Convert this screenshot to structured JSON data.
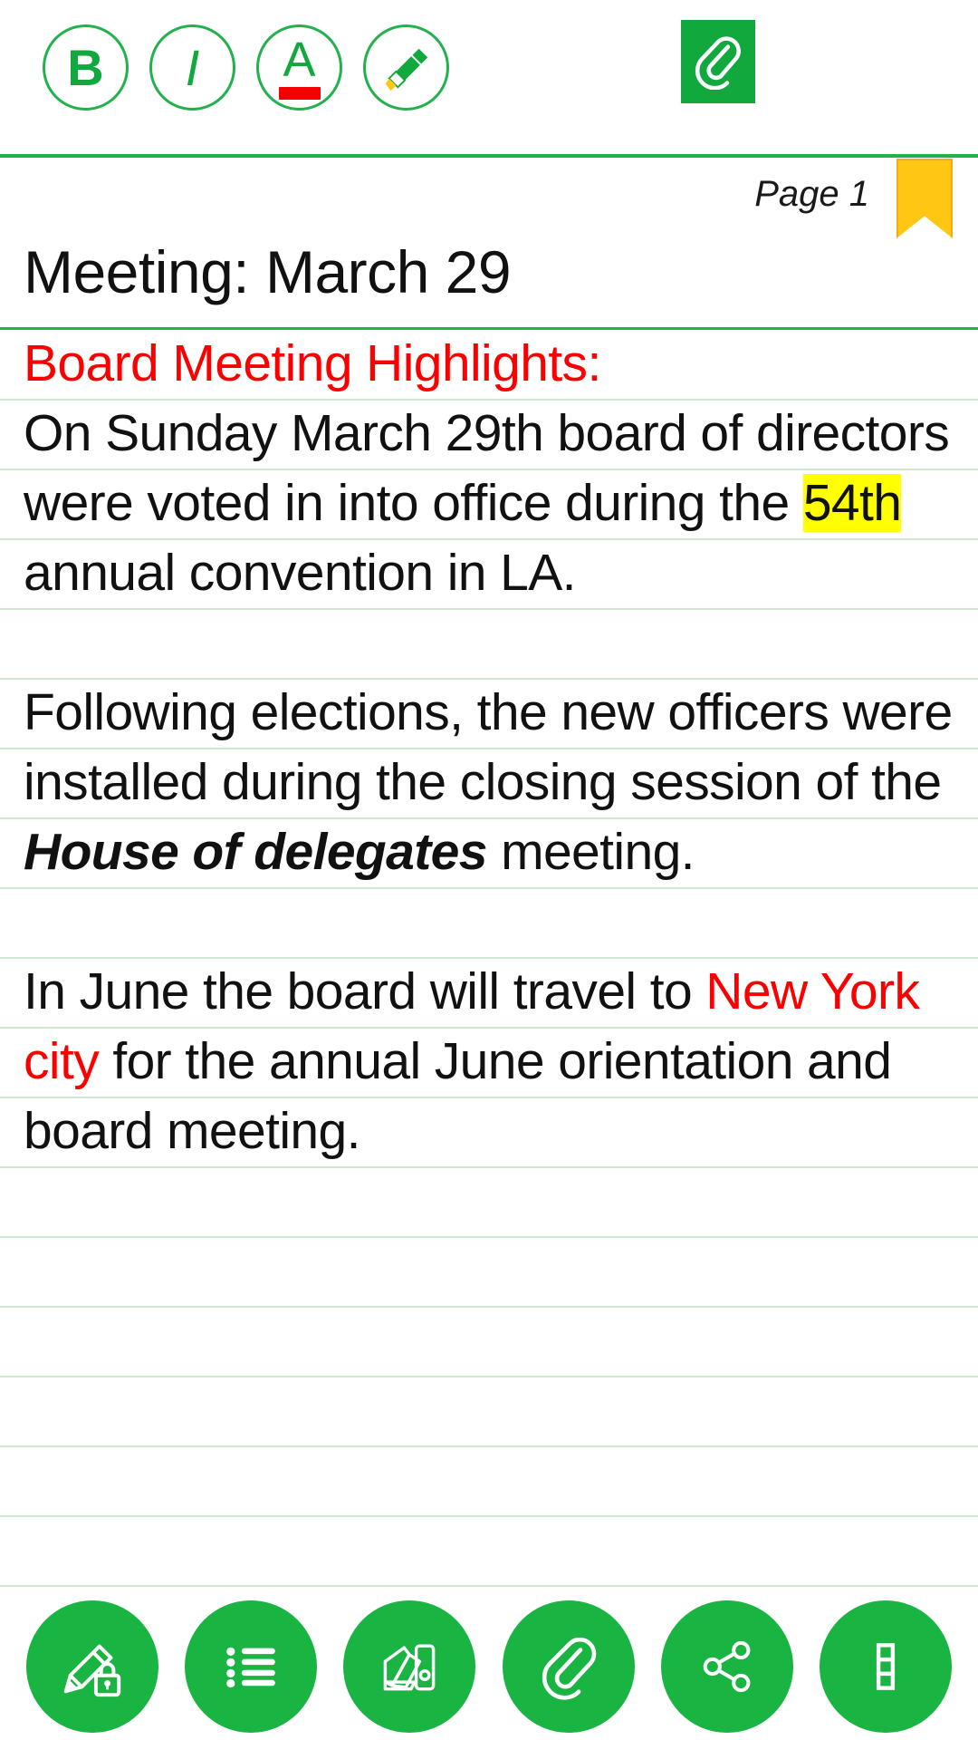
{
  "format_toolbar": {
    "bold_label": "B",
    "italic_label": "I",
    "text_color_label": "A",
    "text_color_swatch": "#f50000",
    "highlighter_name": "highlighter-marker-icon",
    "attach_name": "paperclip-icon",
    "accent_color": "#11a93d"
  },
  "note_header": {
    "page_label": "Page 1",
    "bookmark_color": "#ffc614",
    "title": "Meeting: March 29"
  },
  "note_body": {
    "paragraphs": [
      {
        "id": "p1",
        "runs": [
          {
            "text": "Board Meeting Highlights:",
            "style": "red"
          },
          {
            "text": "\n",
            "style": "break"
          },
          {
            "text": "On Sunday March 29th board of directors were voted in into office during the ",
            "style": "plain"
          },
          {
            "text": "54th",
            "style": "highlight"
          },
          {
            "text": " annual convention in LA.",
            "style": "plain"
          }
        ]
      },
      {
        "id": "p2",
        "runs": [
          {
            "text": "Following elections, the new officers were installed during the closing session of the ",
            "style": "plain"
          },
          {
            "text": "House of delegates",
            "style": "italic"
          },
          {
            "text": " meeting.",
            "style": "plain"
          }
        ]
      },
      {
        "id": "p3",
        "runs": [
          {
            "text": "In June the board will travel to ",
            "style": "plain"
          },
          {
            "text": "New York city",
            "style": "red"
          },
          {
            "text": " for the annual June orientation and board meeting.",
            "style": "plain"
          }
        ]
      }
    ],
    "heading_color": "#fb0000",
    "highlight_color": "#ffff00",
    "rule_line_color": "#cfe8d2"
  },
  "action_bar": {
    "button_color": "#19b442",
    "buttons": [
      {
        "name": "lock-note-icon",
        "label": "Lock note"
      },
      {
        "name": "checklist-icon",
        "label": "Checklist"
      },
      {
        "name": "color-palette-icon",
        "label": "Colors"
      },
      {
        "name": "paperclip-icon",
        "label": "Attach"
      },
      {
        "name": "share-icon",
        "label": "Share"
      },
      {
        "name": "more-options-icon",
        "label": "More"
      }
    ]
  }
}
